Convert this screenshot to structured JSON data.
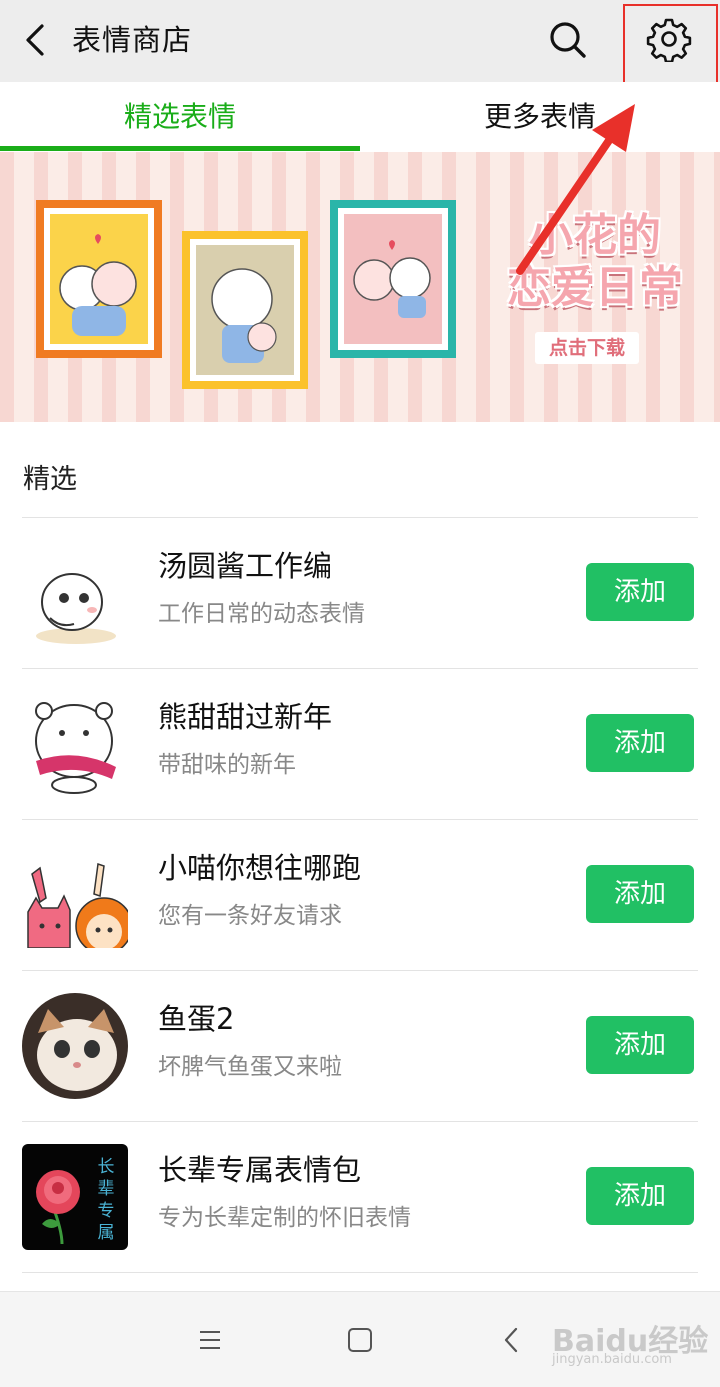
{
  "header": {
    "title": "表情商店"
  },
  "tabs": [
    {
      "label": "精选表情"
    },
    {
      "label": "更多表情"
    }
  ],
  "banner": {
    "title_line1": "小花的",
    "title_line2": "恋爱日常",
    "button": "点击下载"
  },
  "section": {
    "title": "精选"
  },
  "items": [
    {
      "name": "汤圆酱工作编",
      "desc": "工作日常的动态表情",
      "button": "添加"
    },
    {
      "name": "熊甜甜过新年",
      "desc": "带甜味的新年",
      "button": "添加"
    },
    {
      "name": "小喵你想往哪跑",
      "desc": "您有一条好友请求",
      "button": "添加"
    },
    {
      "name": "鱼蛋2",
      "desc": "坏脾气鱼蛋又来啦",
      "button": "添加"
    },
    {
      "name": "长辈专属表情包",
      "desc": "专为长辈定制的怀旧表情",
      "button": "添加"
    }
  ],
  "thumb_text": {
    "item5": "长辈专属"
  },
  "watermark": {
    "main": "Baidu经验",
    "sub": "jingyan.baidu.com"
  },
  "colors": {
    "accent": "#1aad19",
    "button": "#21c064",
    "highlight": "#e8302a"
  }
}
